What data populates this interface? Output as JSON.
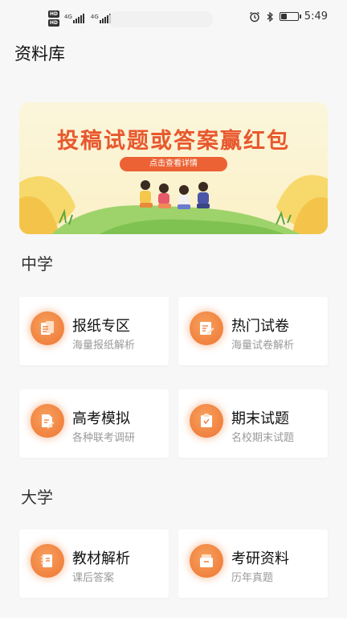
{
  "status_bar": {
    "hd_label": "HD",
    "net_label": "4G",
    "time": "5:49"
  },
  "page": {
    "title": "资料库"
  },
  "banner": {
    "title": "投稿试题或答案赢红包",
    "button_label": "点击查看详情"
  },
  "sections": [
    {
      "title": "中学",
      "cards": [
        {
          "title": "报纸专区",
          "subtitle": "海量报纸解析",
          "icon": "newspaper-icon"
        },
        {
          "title": "热门试卷",
          "subtitle": "海量试卷解析",
          "icon": "edit-paper-icon"
        },
        {
          "title": "高考模拟",
          "subtitle": "各种联考调研",
          "icon": "doc-pen-icon"
        },
        {
          "title": "期末试题",
          "subtitle": "名校期末试题",
          "icon": "clipboard-icon"
        }
      ]
    },
    {
      "title": "大学",
      "cards": [
        {
          "title": "教材解析",
          "subtitle": "课后答案",
          "icon": "notebook-icon"
        },
        {
          "title": "考研资料",
          "subtitle": "历年真题",
          "icon": "folder-icon"
        }
      ]
    }
  ],
  "colors": {
    "accent": "#ee7431",
    "banner_text": "#e8582e",
    "background": "#f7f7f7"
  }
}
